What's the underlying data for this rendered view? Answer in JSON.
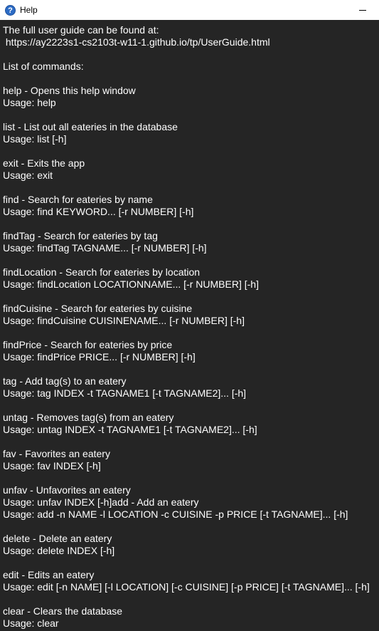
{
  "window": {
    "title": "Help",
    "icon": "help-question-icon",
    "minimize_icon": "minimize-icon"
  },
  "help": {
    "text": "The full user guide can be found at:\n https://ay2223s1-cs2103t-w11-1.github.io/tp/UserGuide.html\n\nList of commands:\n\nhelp - Opens this help window\nUsage: help\n\nlist - List out all eateries in the database\nUsage: list [-h]\n\nexit - Exits the app\nUsage: exit\n\nfind - Search for eateries by name\nUsage: find KEYWORD... [-r NUMBER] [-h]\n\nfindTag - Search for eateries by tag\nUsage: findTag TAGNAME... [-r NUMBER] [-h]\n\nfindLocation - Search for eateries by location\nUsage: findLocation LOCATIONNAME... [-r NUMBER] [-h]\n\nfindCuisine - Search for eateries by cuisine\nUsage: findCuisine CUISINENAME... [-r NUMBER] [-h]\n\nfindPrice - Search for eateries by price\nUsage: findPrice PRICE... [-r NUMBER] [-h]\n\ntag - Add tag(s) to an eatery\nUsage: tag INDEX -t TAGNAME1 [-t TAGNAME2]... [-h]\n\nuntag - Removes tag(s) from an eatery\nUsage: untag INDEX -t TAGNAME1 [-t TAGNAME2]... [-h]\n\nfav - Favorites an eatery\nUsage: fav INDEX [-h]\n\nunfav - Unfavorites an eatery\nUsage: unfav INDEX [-h]add - Add an eatery\nUsage: add -n NAME -l LOCATION -c CUISINE -p PRICE [-t TAGNAME]... [-h]\n\ndelete - Delete an eatery\nUsage: delete INDEX [-h]\n\nedit - Edits an eatery\nUsage: edit [-n NAME] [-l LOCATION] [-c CUISINE] [-p PRICE] [-t TAGNAME]... [-h]\n\nclear - Clears the database\nUsage: clear"
  },
  "colors": {
    "background": "#252525",
    "text": "#ffffff",
    "titlebar": "#ffffff",
    "icon": "#2d6cc5"
  }
}
